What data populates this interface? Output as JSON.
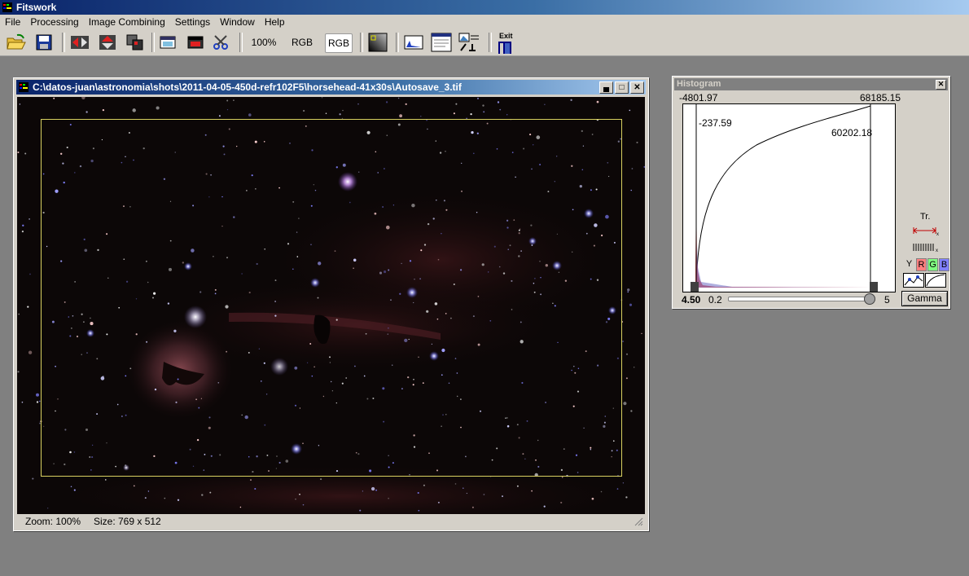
{
  "app": {
    "title": "Fitswork"
  },
  "menu": [
    "File",
    "Processing",
    "Image Combining",
    "Settings",
    "Window",
    "Help"
  ],
  "toolbar": {
    "zoom_label": "100%",
    "rgb_label_1": "RGB",
    "rgb_label_2": "RGB",
    "exit_label": "Exit",
    "icons": [
      "open-folder-icon",
      "save-icon",
      "flip-horizontal-icon",
      "flip-vertical-icon",
      "rotate-icon",
      "window-icon",
      "window-dark-icon",
      "crop-scissors-icon",
      "curve-gradient-icon",
      "histogram-window-icon",
      "image-info-icon",
      "level-adjust-icon",
      "exit-icon"
    ]
  },
  "image_window": {
    "title": "C:\\datos-juan\\astronomia\\shots\\2011-04-05-450d-refr102F5\\horsehead-41x30s\\Autosave_3.tif",
    "status_zoom": "Zoom: 100%",
    "status_size": "Size: 769 x 512"
  },
  "histogram": {
    "title": "Histogram",
    "min_value": "-4801.97",
    "max_value": "68185.15",
    "left_marker": "-237.59",
    "right_marker": "60202.18",
    "gamma_value": "4.50",
    "slider_min": "0.2",
    "slider_max": "5",
    "gamma_button": "Gamma",
    "tr_label": "Tr.",
    "channels": [
      "Y",
      "R",
      "G",
      "B"
    ],
    "channel_colors": {
      "R": "#ff8080",
      "G": "#80ff80",
      "B": "#8080ff"
    }
  }
}
